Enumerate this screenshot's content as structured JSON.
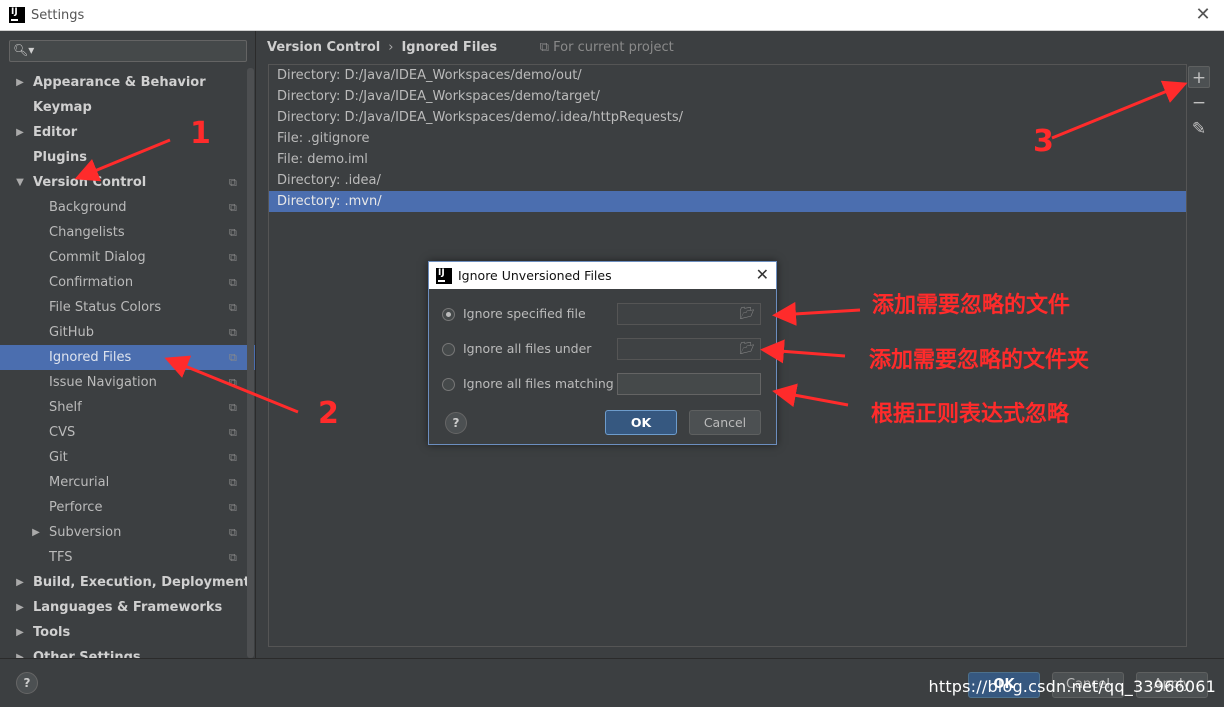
{
  "window": {
    "title": "Settings",
    "logo_text": "IJ"
  },
  "sidebar": {
    "search_placeholder": "",
    "items": [
      {
        "label": "Appearance & Behavior",
        "level": 0,
        "arrow": "▶",
        "bold": true
      },
      {
        "label": "Keymap",
        "level": 0,
        "arrow": "",
        "bold": true
      },
      {
        "label": "Editor",
        "level": 0,
        "arrow": "▶",
        "bold": true
      },
      {
        "label": "Plugins",
        "level": 0,
        "arrow": "",
        "bold": true
      },
      {
        "label": "Version Control",
        "level": 0,
        "arrow": "▼",
        "bold": true,
        "copy": true
      },
      {
        "label": "Background",
        "level": 1,
        "copy": true
      },
      {
        "label": "Changelists",
        "level": 1,
        "copy": true
      },
      {
        "label": "Commit Dialog",
        "level": 1,
        "copy": true
      },
      {
        "label": "Confirmation",
        "level": 1,
        "copy": true
      },
      {
        "label": "File Status Colors",
        "level": 1,
        "copy": true
      },
      {
        "label": "GitHub",
        "level": 1,
        "copy": true
      },
      {
        "label": "Ignored Files",
        "level": 1,
        "copy": true,
        "selected": true
      },
      {
        "label": "Issue Navigation",
        "level": 1,
        "copy": true
      },
      {
        "label": "Shelf",
        "level": 1,
        "copy": true
      },
      {
        "label": "CVS",
        "level": 1,
        "copy": true
      },
      {
        "label": "Git",
        "level": 1,
        "copy": true
      },
      {
        "label": "Mercurial",
        "level": 1,
        "copy": true
      },
      {
        "label": "Perforce",
        "level": 1,
        "copy": true
      },
      {
        "label": "Subversion",
        "level": 1,
        "arrow": "▶",
        "copy": true
      },
      {
        "label": "TFS",
        "level": 1,
        "copy": true
      },
      {
        "label": "Build, Execution, Deployment",
        "level": 0,
        "arrow": "▶",
        "bold": true
      },
      {
        "label": "Languages & Frameworks",
        "level": 0,
        "arrow": "▶",
        "bold": true
      },
      {
        "label": "Tools",
        "level": 0,
        "arrow": "▶",
        "bold": true
      },
      {
        "label": "Other Settings",
        "level": 0,
        "arrow": "▶",
        "bold": true
      }
    ]
  },
  "breadcrumb": {
    "parent": "Version Control",
    "separator": "›",
    "current": "Ignored Files",
    "project_note": "For current project"
  },
  "ignored_files": {
    "rows": [
      "Directory: D:/Java/IDEA_Workspaces/demo/out/",
      "Directory: D:/Java/IDEA_Workspaces/demo/target/",
      "Directory: D:/Java/IDEA_Workspaces/demo/.idea/httpRequests/",
      "File: .gitignore",
      "File: demo.iml",
      "Directory: .idea/",
      "Directory: .mvn/"
    ],
    "selected_index": 6
  },
  "toolbar": {
    "add": "+",
    "remove": "−",
    "edit": "✎"
  },
  "bottom": {
    "help": "?",
    "ok": "OK",
    "cancel": "Cancel",
    "apply": "Apply",
    "watermark": "https://blog.csdn.net/qq_33966061"
  },
  "dialog": {
    "title": "Ignore Unversioned Files",
    "options": [
      {
        "label": "Ignore specified file",
        "checked": true
      },
      {
        "label": "Ignore all files under",
        "checked": false
      },
      {
        "label": "Ignore all files matching",
        "checked": false
      }
    ],
    "help": "?",
    "ok": "OK",
    "cancel": "Cancel"
  },
  "annotations": {
    "num1": "1",
    "num2": "2",
    "num3": "3",
    "note_file": "添加需要忽略的文件",
    "note_folder": "添加需要忽略的文件夹",
    "note_regex": "根据正则表达式忽略",
    "color": "#ff2b2b"
  }
}
